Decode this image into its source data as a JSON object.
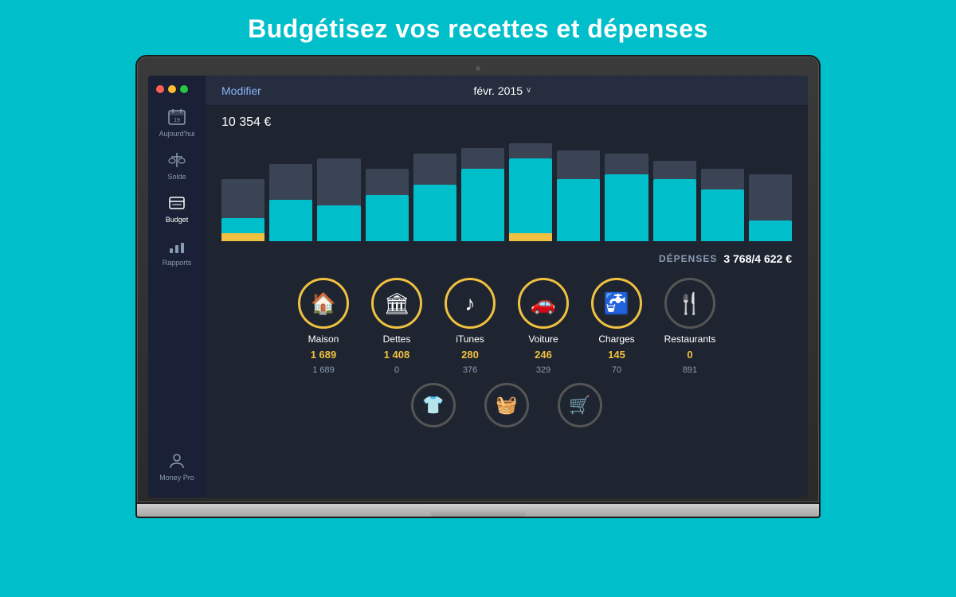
{
  "page": {
    "title": "Budgétisez vos recettes et dépenses",
    "bg_color": "#00BFCA"
  },
  "topbar": {
    "modifier_label": "Modifier",
    "date_label": "févr. 2015",
    "chevron": "∨"
  },
  "chart": {
    "amount": "10 354 €",
    "bars": [
      {
        "outer": 60,
        "inner": 22,
        "yellow": true,
        "outline": true
      },
      {
        "outer": 75,
        "inner": 40,
        "yellow": false,
        "outline": true
      },
      {
        "outer": 80,
        "inner": 35,
        "yellow": false,
        "outline": true
      },
      {
        "outer": 70,
        "inner": 45,
        "yellow": false,
        "outline": true
      },
      {
        "outer": 85,
        "inner": 55,
        "yellow": false,
        "outline": true
      },
      {
        "outer": 90,
        "inner": 70,
        "yellow": false,
        "outline": true
      },
      {
        "outer": 95,
        "inner": 80,
        "yellow": true,
        "outline": true
      },
      {
        "outer": 88,
        "inner": 60,
        "yellow": false,
        "outline": true
      },
      {
        "outer": 85,
        "inner": 65,
        "yellow": false,
        "outline": true
      },
      {
        "outer": 78,
        "inner": 60,
        "yellow": false,
        "outline": true
      },
      {
        "outer": 70,
        "inner": 50,
        "yellow": false,
        "outline": true
      },
      {
        "outer": 65,
        "inner": 20,
        "yellow": false,
        "outline": false
      }
    ]
  },
  "expenses": {
    "label": "DÉPENSES",
    "spent": "3 768",
    "budget": "/4 622 €"
  },
  "sidebar": {
    "items": [
      {
        "id": "aujourd-hui",
        "label": "Aujourd'hui",
        "active": false
      },
      {
        "id": "solde",
        "label": "Solde",
        "active": false
      },
      {
        "id": "budget",
        "label": "Budget",
        "active": true
      },
      {
        "id": "rapports",
        "label": "Rapports",
        "active": false
      },
      {
        "id": "money-pro",
        "label": "Money Pro",
        "active": false
      }
    ]
  },
  "categories": [
    {
      "id": "maison",
      "name": "Maison",
      "icon": "🏠",
      "spent": "1 689",
      "budget": "1 689",
      "gold": true
    },
    {
      "id": "dettes",
      "name": "Dettes",
      "icon": "🏛",
      "spent": "1 408",
      "budget": "0",
      "gold": true
    },
    {
      "id": "itunes",
      "name": "iTunes",
      "icon": "♪",
      "spent": "280",
      "budget": "376",
      "gold": true
    },
    {
      "id": "voiture",
      "name": "Voiture",
      "icon": "🚗",
      "spent": "246",
      "budget": "329",
      "gold": true
    },
    {
      "id": "charges",
      "name": "Charges",
      "icon": "🚰",
      "spent": "145",
      "budget": "70",
      "gold": true
    },
    {
      "id": "restaurants",
      "name": "Restaurants",
      "icon": "🍴",
      "spent": "0",
      "budget": "891",
      "gold": false
    }
  ],
  "categories2": [
    {
      "id": "vetements",
      "icon": "👕"
    },
    {
      "id": "courses",
      "icon": "🧺"
    },
    {
      "id": "shopping",
      "icon": "🛒"
    }
  ]
}
